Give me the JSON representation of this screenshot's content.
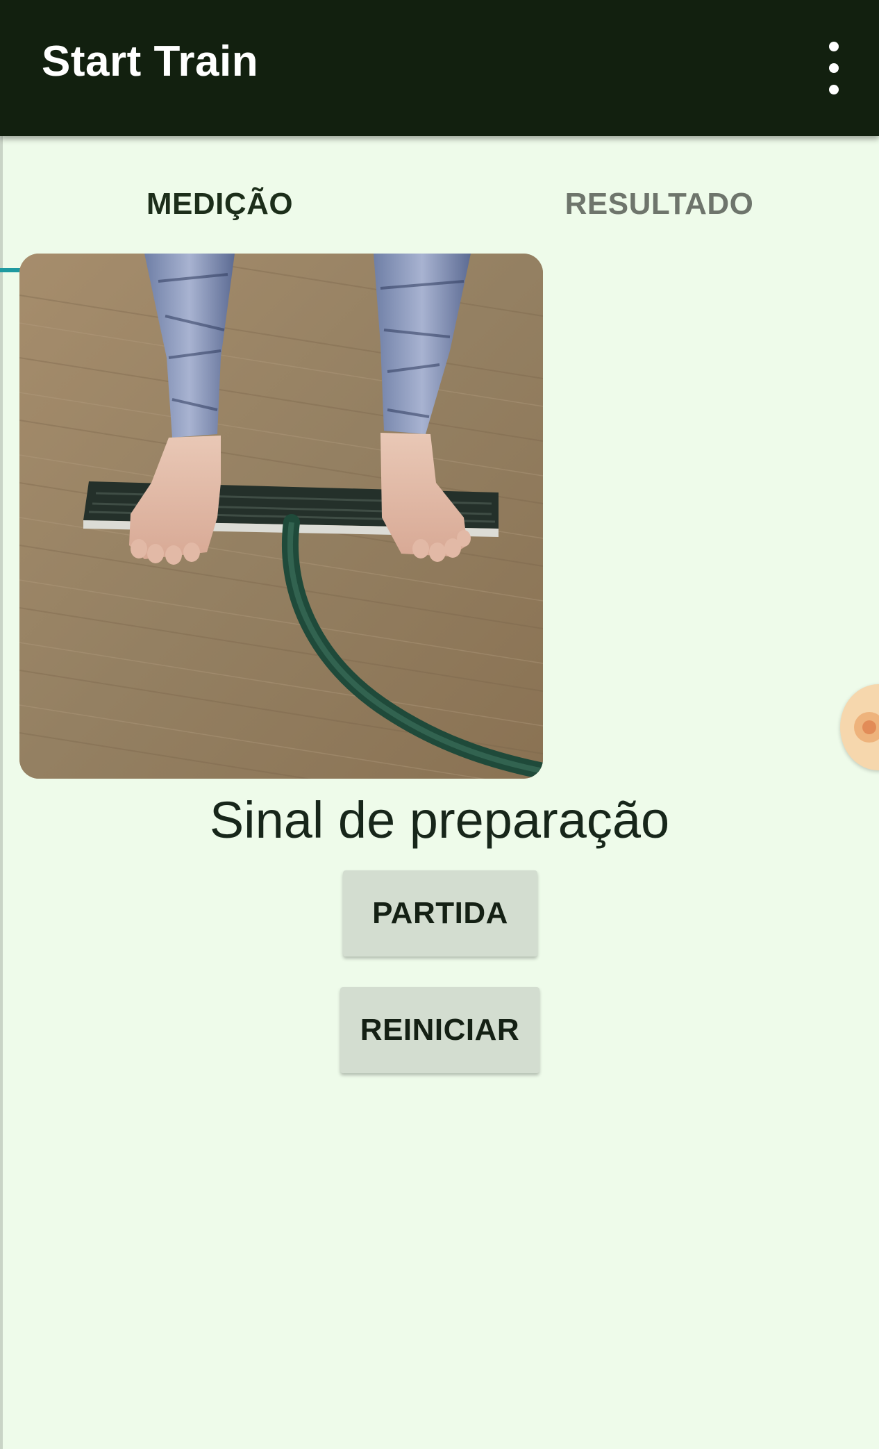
{
  "app_bar": {
    "title": "Start Train",
    "menu_icon": "more-vert-icon"
  },
  "tabs": [
    {
      "label": "MEDIÇÃO",
      "selected": true
    },
    {
      "label": "RESULTADO",
      "selected": false
    }
  ],
  "main": {
    "image": "feet-on-start-mat-photo",
    "status_text": "Sinal de preparação",
    "buttons": {
      "start_label": "PARTIDA",
      "reset_label": "REINICIAR"
    }
  },
  "colors": {
    "app_bar": "#12200f",
    "background": "#eefbea",
    "tab_indicator": "#1f9aa0",
    "button_bg": "#d3ddd0"
  }
}
